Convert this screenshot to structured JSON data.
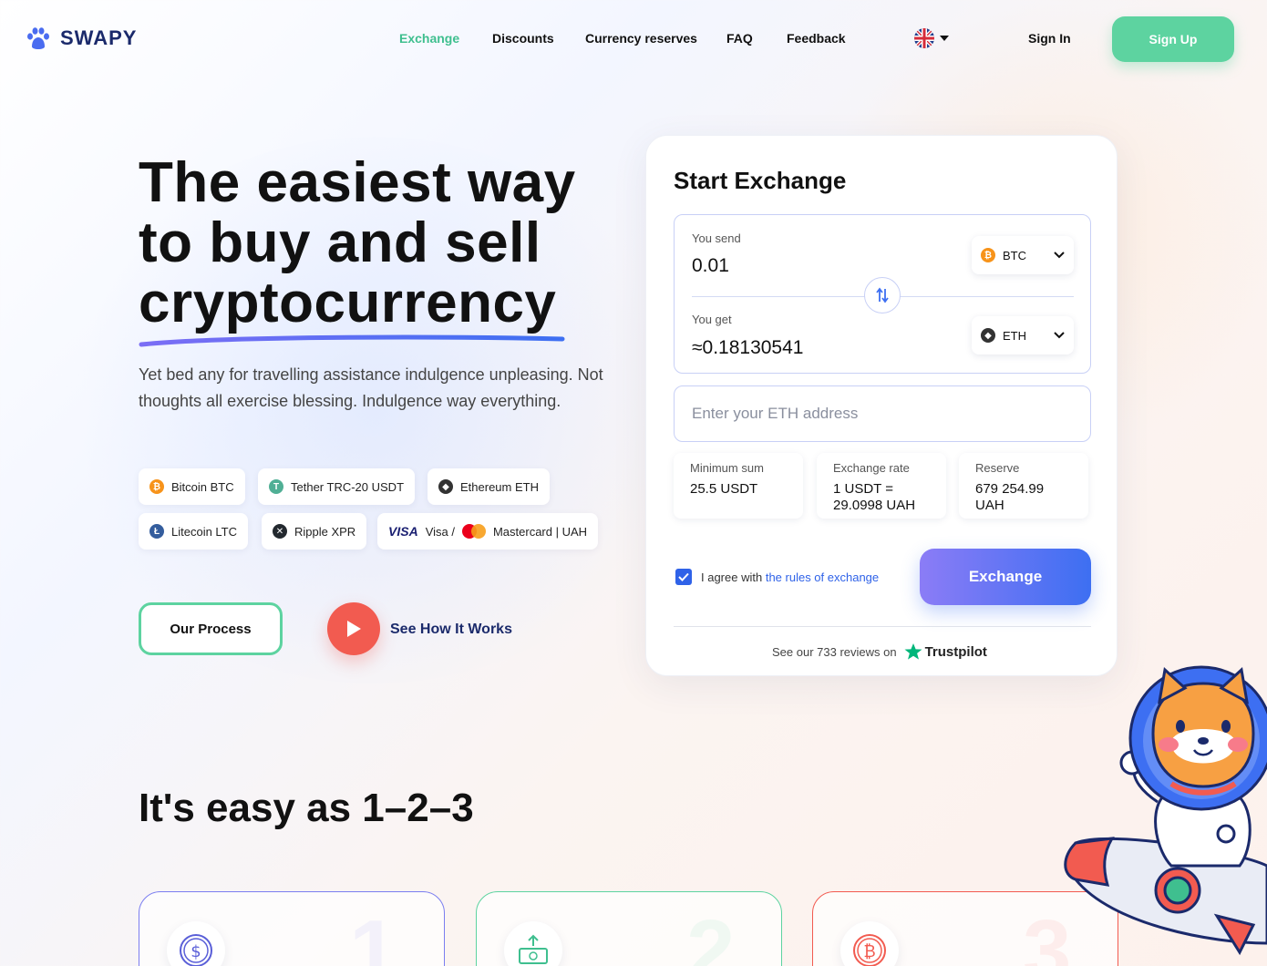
{
  "header": {
    "logo_text": "SWAPY",
    "nav": [
      {
        "label": "Exchange",
        "active": true
      },
      {
        "label": "Discounts"
      },
      {
        "label": "Currency reserves"
      },
      {
        "label": "FAQ"
      },
      {
        "label": "Feedback"
      }
    ],
    "language_icon": "uk-flag-icon",
    "sign_in": "Sign In",
    "sign_up": "Sign Up"
  },
  "hero": {
    "title_line1": "The easiest way",
    "title_line2": "to buy and sell",
    "title_line3": "cryptocurrency",
    "description": "Yet bed any for travelling assistance indulgence unpleasing. Not thoughts all exercise blessing. Indulgence way everything.",
    "chips": [
      {
        "label": "Bitcoin BTC",
        "icon": "bitcoin-icon",
        "color": "#f7931a"
      },
      {
        "label": "Tether TRC-20 USDT",
        "icon": "tether-icon",
        "color": "#50af95"
      },
      {
        "label": "Ethereum ETH",
        "icon": "ethereum-icon",
        "color": "#333333"
      },
      {
        "label": "Litecoin LTC",
        "icon": "litecoin-icon",
        "color": "#345d9d"
      },
      {
        "label": "Ripple XPR",
        "icon": "ripple-icon",
        "color": "#23292f"
      },
      {
        "label_visa": "VISA",
        "label_1": "Visa /",
        "label_2": "Mastercard | UAH",
        "icon": "visa-mastercard-icon"
      }
    ],
    "process_button": "Our Process",
    "see_how": "See How It Works"
  },
  "exchange": {
    "title": "Start Exchange",
    "send_label": "You send",
    "send_value": "0.01",
    "send_currency": "BTC",
    "get_label": "You get",
    "get_value": "≈0.18130541",
    "get_currency": "ETH",
    "address_placeholder": "Enter your ETH address",
    "stats": [
      {
        "label": "Minimum sum",
        "value": "25.5 USDT"
      },
      {
        "label": "Exchange rate",
        "value_line1": "1 USDT =",
        "value_line2": "29.0998 UAH"
      },
      {
        "label": "Reserve",
        "value_line1": "679 254.99",
        "value_line2": "UAH"
      }
    ],
    "agree_text": "I agree with",
    "rules_link": "the rules of exchange",
    "agree_checked": true,
    "exchange_button": "Exchange",
    "reviews_text": "See our 733 reviews on",
    "trustpilot": "Trustpilot"
  },
  "steps_section": {
    "title": "It's easy as 1–2–3",
    "steps": [
      {
        "number": "1",
        "icon": "dollar-coin-icon",
        "color": "#7b7ef0"
      },
      {
        "number": "2",
        "icon": "cash-upload-icon",
        "color": "#5dd3a0"
      },
      {
        "number": "3",
        "icon": "bitcoin-coin-icon",
        "color": "#f25b50"
      }
    ]
  },
  "colors": {
    "accent_green": "#5dd3a0",
    "accent_blue": "#3d6ff2",
    "accent_red": "#f25b50",
    "navy": "#1b2a6b"
  }
}
